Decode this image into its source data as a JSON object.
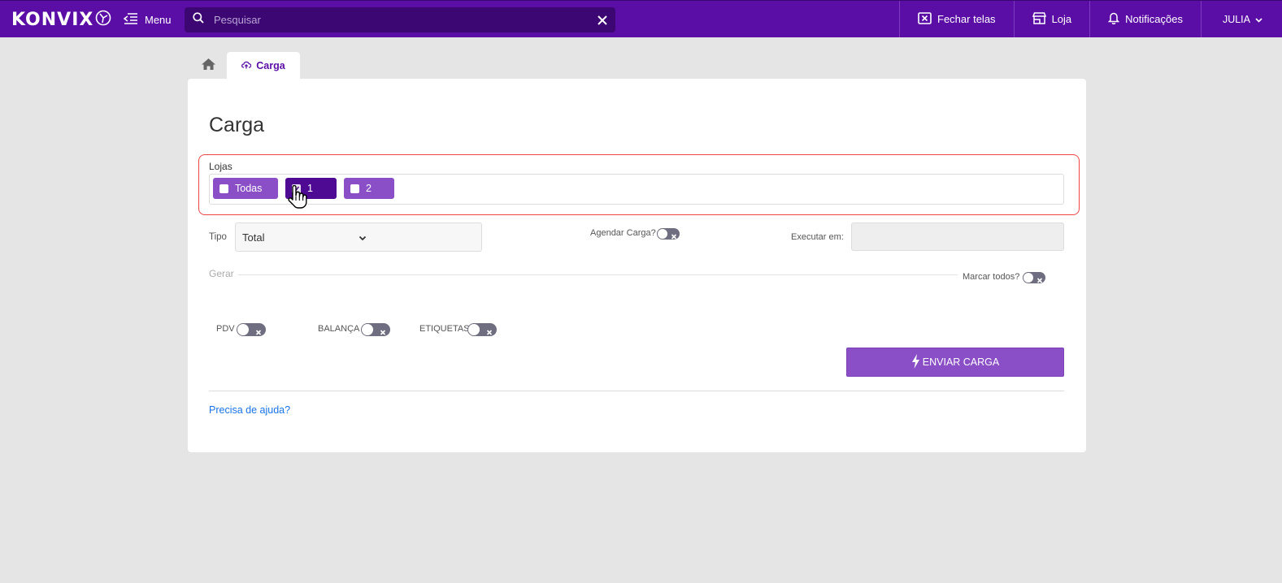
{
  "brand": {
    "logo_text": "KONVIX"
  },
  "topbar": {
    "menu_label": "Menu",
    "search_placeholder": "Pesquisar",
    "fechar_telas": "Fechar telas",
    "loja": "Loja",
    "notificacoes": "Notificações",
    "user": "JULIA"
  },
  "tabs": {
    "carga": "Carga"
  },
  "page": {
    "title": "Carga",
    "lojas_label": "Lojas",
    "lojas": [
      {
        "label": "Todas",
        "checked": false
      },
      {
        "label": "1",
        "checked": true
      },
      {
        "label": "2",
        "checked": false
      }
    ],
    "tipo_label": "Tipo",
    "tipo_value": "Total",
    "agendar_label": "Agendar Carga?",
    "executar_label": "Executar em:",
    "gerar_label": "Gerar",
    "marcar_label": "Marcar todos?",
    "pdv_label": "PDV",
    "balanca_label": "BALANÇA",
    "etiquetas_label": "ETIQUETAS",
    "enviar_label": "ENVIAR CARGA",
    "help_link": "Precisa de ajuda?"
  },
  "colors": {
    "topbar": "#5b0ea6",
    "search_bg": "#3c0773",
    "chip": "#8a4ec6",
    "chip_selected": "#4f0a93",
    "highlight_border": "#ee4444",
    "link": "#1a73e8"
  }
}
